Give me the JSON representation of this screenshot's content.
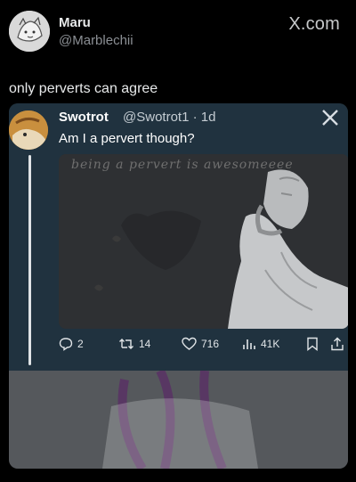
{
  "outer_post": {
    "display_name": "Maru",
    "handle": "@Marblechii",
    "brand": "X.com",
    "text": "only perverts can agree"
  },
  "quoted_post": {
    "display_name": "Swotrot",
    "handle_time": "@Swotrot1 · 1d",
    "text": "Am I a pervert though?",
    "meme_text": "being a pervert is awesomeeee",
    "actions": {
      "replies": "2",
      "reposts": "14",
      "likes": "716",
      "views": "41K"
    }
  },
  "icons": [
    "avatar",
    "x-logo-icon",
    "reply-icon",
    "repost-icon",
    "like-icon",
    "views-icon",
    "bookmark-icon",
    "share-icon"
  ]
}
